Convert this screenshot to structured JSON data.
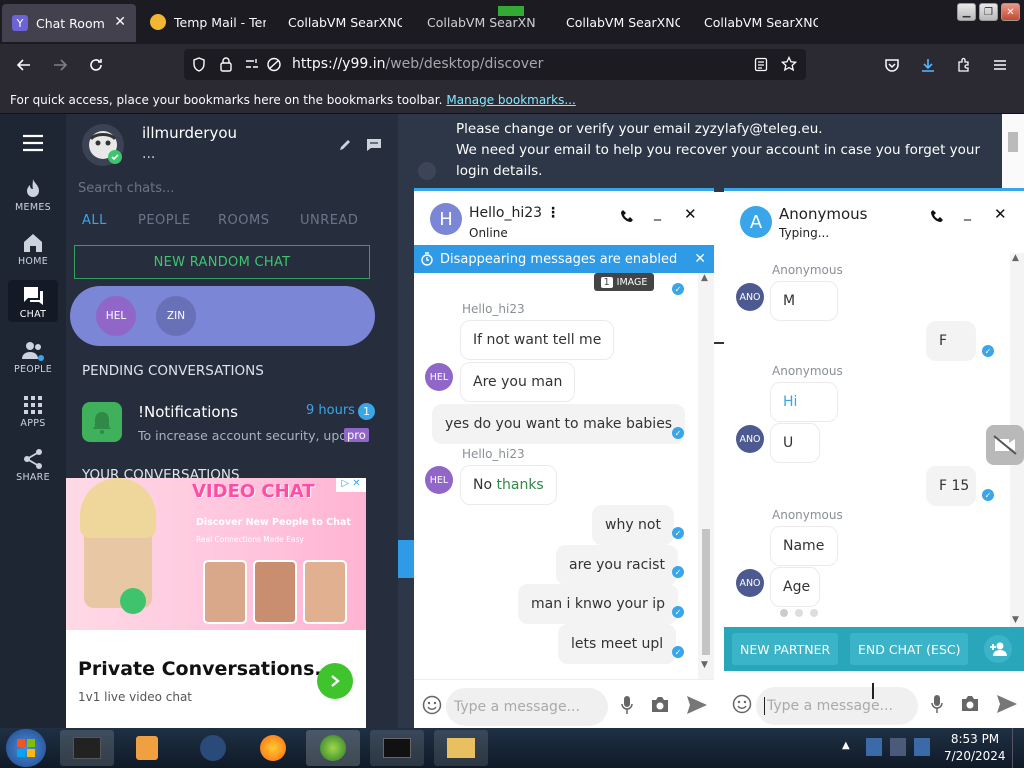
{
  "browser": {
    "tabs": [
      {
        "label": "Chat Room",
        "active": true,
        "favicon_color": "#6c63d6",
        "favicon_letter": "Y"
      },
      {
        "label": "Temp Mail - Temp",
        "active": false,
        "favicon_color": "#f2b632"
      },
      {
        "label": "CollabVM SearXNG",
        "active": false
      },
      {
        "label": "CollabVM SearXNG",
        "active": false
      },
      {
        "label": "CollabVM SearXNG",
        "active": false
      },
      {
        "label": "CollabVM SearXNG",
        "active": false
      }
    ],
    "url_host": "https://y99.in",
    "url_path": "/web/desktop/discover",
    "bookmarks_text": "For quick access, place your bookmarks here on the bookmarks toolbar.",
    "bookmarks_link": "Manage bookmarks..."
  },
  "rail": [
    {
      "label": "MEMES",
      "icon": "flame-icon"
    },
    {
      "label": "HOME",
      "icon": "home-icon"
    },
    {
      "label": "CHAT",
      "icon": "chat-icon",
      "selected": true
    },
    {
      "label": "PEOPLE",
      "icon": "people-icon"
    },
    {
      "label": "APPS",
      "icon": "apps-grid-icon"
    },
    {
      "label": "SHARE",
      "icon": "share-icon"
    }
  ],
  "profile": {
    "username": "illmurderyou",
    "status": "..."
  },
  "search": {
    "placeholder": "Search chats..."
  },
  "filters": [
    "ALL",
    "PEOPLE",
    "ROOMS",
    "UNREAD"
  ],
  "random_chat_label": "NEW RANDOM CHAT",
  "active_chats": [
    "HEL",
    "ZIN"
  ],
  "pending": {
    "heading": "PENDING CONVERSATIONS",
    "item_title": "!Notifications",
    "item_time": "9 hours",
    "item_badge": "1",
    "item_preview": "To increase account security, upda",
    "item_tag": "pro"
  },
  "your_conversations_heading": "YOUR CONVERSATIONS",
  "notice": {
    "line1": "Please change or verify your email zyzylafy@teleg.eu.",
    "line2": "We need your email to help you recover your account in case you forget your login details."
  },
  "chat_left": {
    "avatar_letter": "H",
    "avatar_color": "#7b86d6",
    "name": "Hello_hi23",
    "status": "Online",
    "banner": "Disappearing messages are enabled",
    "image_label": "IMAGE",
    "messages": [
      {
        "sender": "Hello_hi23",
        "text": "If not want tell me"
      },
      {
        "text": "Are you man"
      },
      {
        "text": "yes do you want to make babies",
        "mine": true
      },
      {
        "sender": "Hello_hi23",
        "text_prefix": "No ",
        "text_link": "thanks"
      },
      {
        "text": "why not",
        "mine": true
      },
      {
        "text": "are you racist",
        "mine": true
      },
      {
        "text": "man i knwo your ip",
        "mine": true
      },
      {
        "text": "lets meet upl",
        "mine": true
      }
    ],
    "mini_avatar": "HEL",
    "input_placeholder": "Type a message..."
  },
  "chat_right": {
    "avatar_letter": "A",
    "avatar_color": "#3aa5e8",
    "name": "Anonymous",
    "status": "Typing...",
    "messages": [
      {
        "sender": "Anonymous",
        "text": "M"
      },
      {
        "text": "F",
        "mine": true
      },
      {
        "sender": "Anonymous",
        "text": "Hi"
      },
      {
        "text": "U"
      },
      {
        "text": "F 15",
        "mine": true
      },
      {
        "sender": "Anonymous",
        "text": "Name"
      },
      {
        "text": "Age"
      }
    ],
    "mini_avatar": "ANO",
    "new_partner": "NEW PARTNER",
    "end_chat": "END CHAT (ESC)",
    "input_placeholder": "Type a message..."
  },
  "ad": {
    "heading": "VIDEO CHAT",
    "tagline": "Discover New People to Chat",
    "tagline2": "Real Connections Made Easy",
    "title": "Private Conversations.",
    "subtitle": "1v1 live video chat"
  },
  "taskbar": {
    "time": "8:53 PM",
    "date": "7/20/2024"
  },
  "colors": {
    "accent": "#3aa5e8",
    "green": "#3fc46d",
    "purple": "#7b86d6"
  }
}
